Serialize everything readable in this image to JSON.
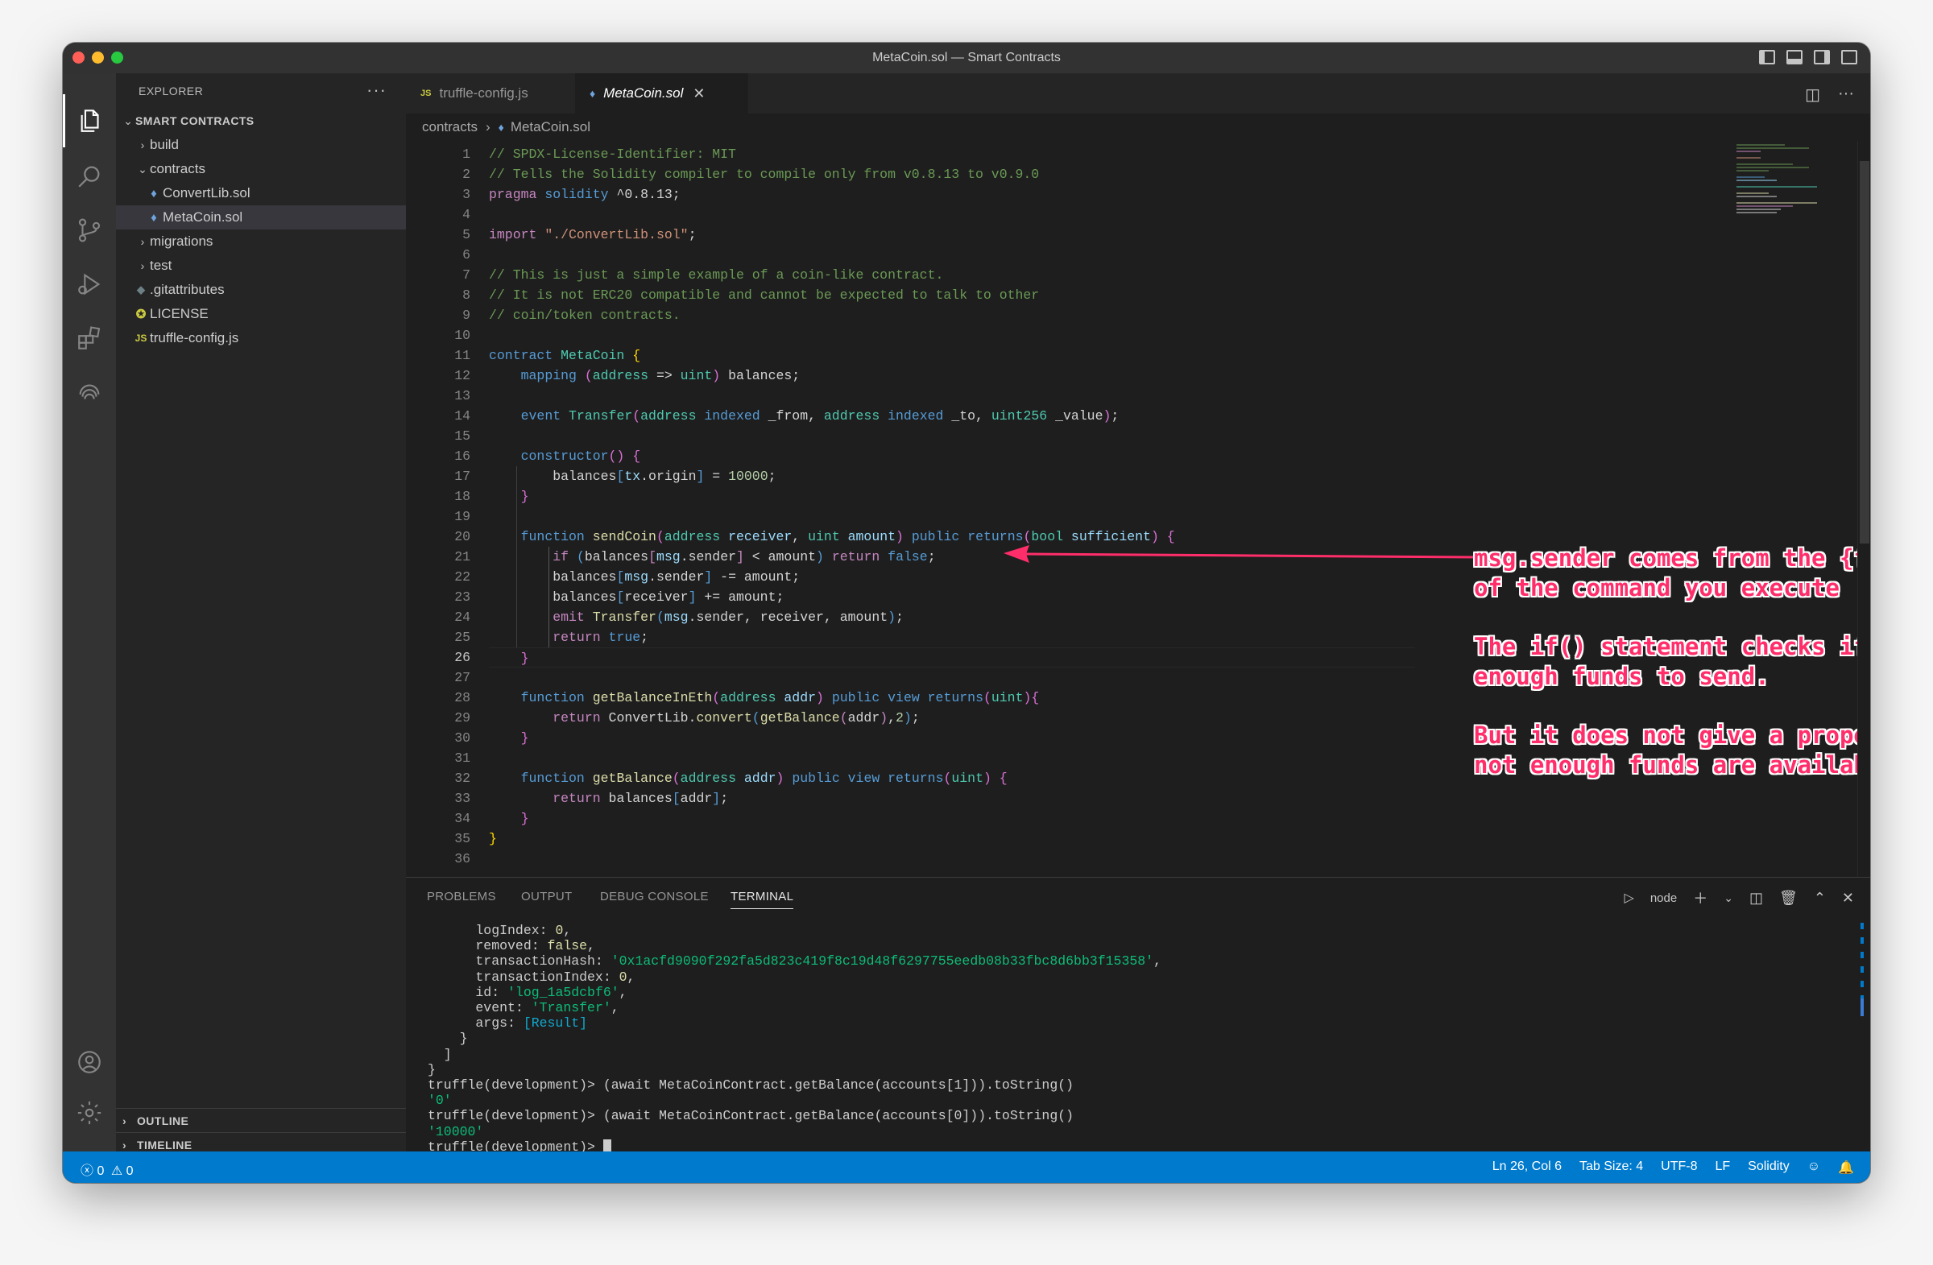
{
  "window": {
    "title": "MetaCoin.sol — Smart Contracts"
  },
  "sidebar": {
    "header": "EXPLORER",
    "more": "···",
    "root": "SMART CONTRACTS",
    "items": [
      {
        "label": "build",
        "icon": "chevron-right"
      },
      {
        "label": "contracts",
        "icon": "chevron-down"
      },
      {
        "label": "ConvertLib.sol",
        "icon": "solidity-icon"
      },
      {
        "label": "MetaCoin.sol",
        "icon": "solidity-icon"
      },
      {
        "label": "migrations",
        "icon": "chevron-right"
      },
      {
        "label": "test",
        "icon": "chevron-right"
      },
      {
        "label": ".gitattributes",
        "icon": "git-icon"
      },
      {
        "label": "LICENSE",
        "icon": "license-icon"
      },
      {
        "label": "truffle-config.js",
        "icon": "js-icon"
      }
    ],
    "outline": "OUTLINE",
    "timeline": "TIMELINE"
  },
  "tabs": [
    {
      "label": "truffle-config.js",
      "icon": "JS"
    },
    {
      "label": "MetaCoin.sol",
      "icon": "♦"
    }
  ],
  "breadcrumb": {
    "folder": "contracts",
    "file": "MetaCoin.sol"
  },
  "editor": {
    "lines": [
      "1",
      "2",
      "3",
      "4",
      "5",
      "6",
      "7",
      "8",
      "9",
      "10",
      "11",
      "12",
      "13",
      "14",
      "15",
      "16",
      "17",
      "18",
      "19",
      "20",
      "21",
      "22",
      "23",
      "24",
      "25",
      "26",
      "27",
      "28",
      "29",
      "30",
      "31",
      "32",
      "33",
      "34",
      "35",
      "36"
    ],
    "current_line": "26"
  },
  "annotations": [
    "msg.sender comes from the {from: accounts[]} part\nof the command you execute",
    "The if() statement checks if the msg.sender has\nenough funds to send.",
    "But it does not give a proper error message when\nnot enough funds are available, which is bad."
  ],
  "panel": {
    "tabs": [
      "PROBLEMS",
      "OUTPUT",
      "DEBUG CONSOLE",
      "TERMINAL"
    ],
    "active": "TERMINAL",
    "terminal_name": "node"
  },
  "status": {
    "errors": "0",
    "warnings": "0",
    "position": "Ln 26, Col 6",
    "tab_size": "Tab Size: 4",
    "encoding": "UTF-8",
    "eol": "LF",
    "language": "Solidity"
  },
  "colors": {
    "status_bar": "#007acc",
    "annotation": "#ff2e6a"
  }
}
